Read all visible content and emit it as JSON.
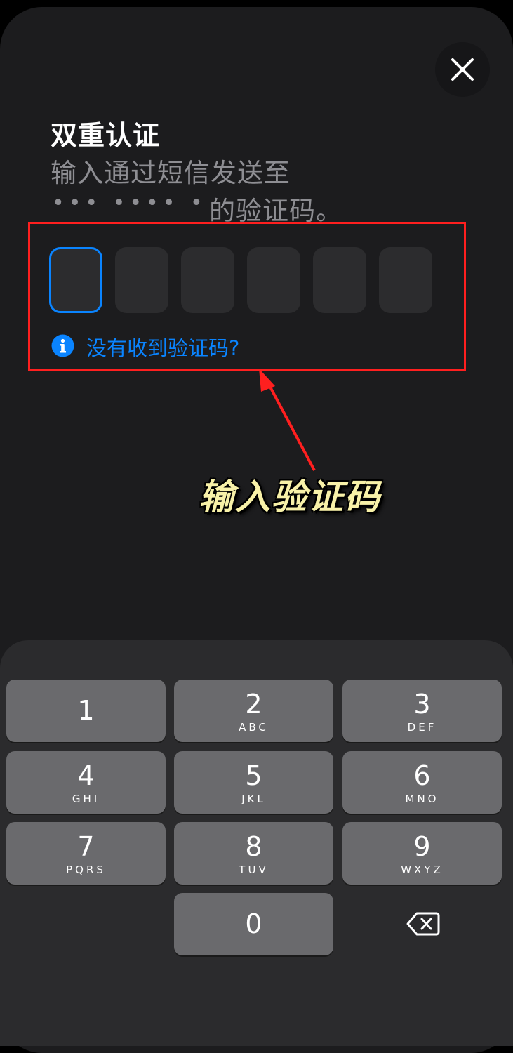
{
  "header": {
    "title": "双重认证",
    "subtitle_line1": "输入通过短信发送至",
    "masked_number": "••• •••• •",
    "subtitle_line2": "的验证码。"
  },
  "code_input": {
    "length": 6,
    "active_index": 0
  },
  "resend": {
    "label": "没有收到验证码?"
  },
  "annotation": {
    "callout_text": "输入验证码",
    "highlight_color": "#ff1f1f",
    "callout_color": "#f8f1a8"
  },
  "keypad": {
    "keys": [
      {
        "digit": "1",
        "letters": ""
      },
      {
        "digit": "2",
        "letters": "ABC"
      },
      {
        "digit": "3",
        "letters": "DEF"
      },
      {
        "digit": "4",
        "letters": "GHI"
      },
      {
        "digit": "5",
        "letters": "JKL"
      },
      {
        "digit": "6",
        "letters": "MNO"
      },
      {
        "digit": "7",
        "letters": "PQRS"
      },
      {
        "digit": "8",
        "letters": "TUV"
      },
      {
        "digit": "9",
        "letters": "WXYZ"
      },
      {
        "digit": "0",
        "letters": ""
      }
    ],
    "delete_icon": "delete-backward-icon"
  },
  "colors": {
    "background": "#1c1c1e",
    "accent": "#0a84ff",
    "key": "#6a6a6d"
  }
}
